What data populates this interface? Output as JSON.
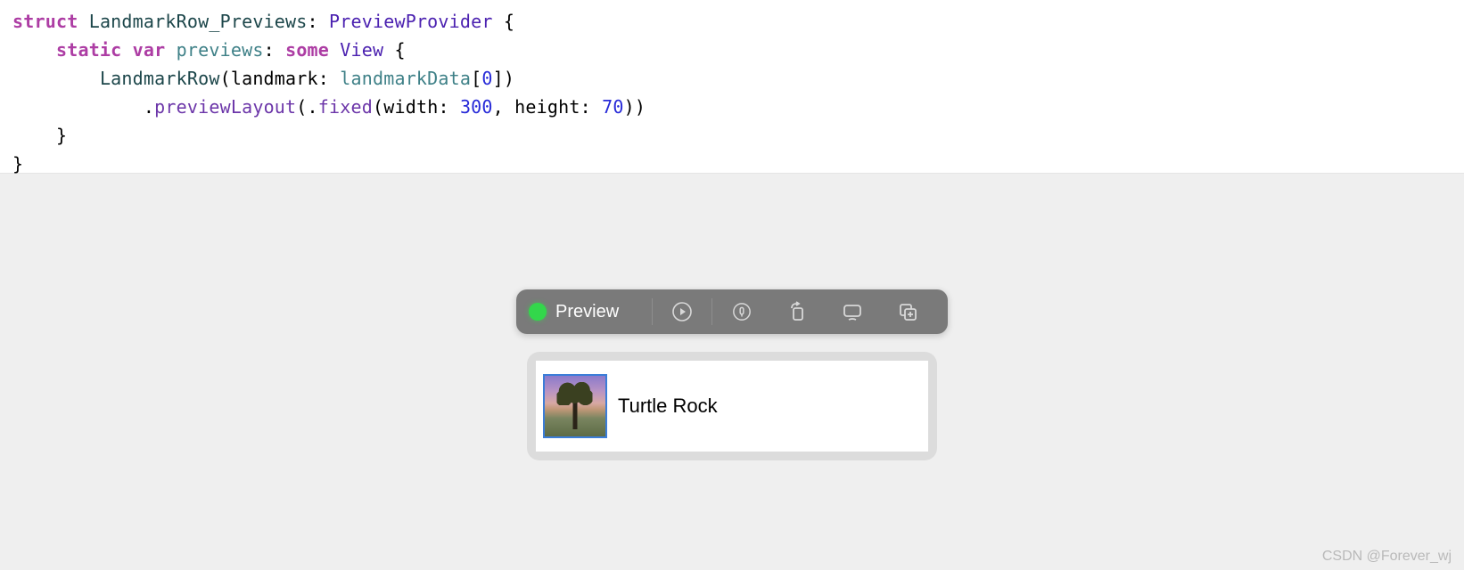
{
  "code": {
    "tokens": [
      {
        "indent": 0,
        "parts": [
          {
            "t": "struct",
            "c": "kw-pink"
          },
          {
            "t": " ",
            "c": "plain"
          },
          {
            "t": "LandmarkRow_Previews",
            "c": "type-teal"
          },
          {
            "t": ": ",
            "c": "plain"
          },
          {
            "t": "PreviewProvider",
            "c": "type-purple"
          },
          {
            "t": " {",
            "c": "plain"
          }
        ]
      },
      {
        "indent": 1,
        "parts": [
          {
            "t": "static",
            "c": "kw-pink"
          },
          {
            "t": " ",
            "c": "plain"
          },
          {
            "t": "var",
            "c": "kw-pink"
          },
          {
            "t": " ",
            "c": "plain"
          },
          {
            "t": "previews",
            "c": "member-teal"
          },
          {
            "t": ": ",
            "c": "plain"
          },
          {
            "t": "some",
            "c": "kw-pink"
          },
          {
            "t": " ",
            "c": "plain"
          },
          {
            "t": "View",
            "c": "type-purple"
          },
          {
            "t": " {",
            "c": "plain"
          }
        ]
      },
      {
        "indent": 2,
        "parts": [
          {
            "t": "LandmarkRow",
            "c": "type-teal"
          },
          {
            "t": "(landmark: ",
            "c": "plain"
          },
          {
            "t": "landmarkData",
            "c": "param-teal"
          },
          {
            "t": "[",
            "c": "plain"
          },
          {
            "t": "0",
            "c": "number-blue"
          },
          {
            "t": "])",
            "c": "plain"
          }
        ]
      },
      {
        "indent": 3,
        "parts": [
          {
            "t": ".",
            "c": "plain"
          },
          {
            "t": "previewLayout",
            "c": "method-purple"
          },
          {
            "t": "(.",
            "c": "plain"
          },
          {
            "t": "fixed",
            "c": "method-purple"
          },
          {
            "t": "(width: ",
            "c": "plain"
          },
          {
            "t": "300",
            "c": "number-blue"
          },
          {
            "t": ", height: ",
            "c": "plain"
          },
          {
            "t": "70",
            "c": "number-blue"
          },
          {
            "t": "))",
            "c": "plain"
          }
        ]
      },
      {
        "indent": 1,
        "parts": [
          {
            "t": "}",
            "c": "plain"
          }
        ]
      },
      {
        "indent": 0,
        "parts": [
          {
            "t": "}",
            "c": "plain"
          }
        ]
      }
    ]
  },
  "toolbar": {
    "status_color": "#33d74b",
    "label": "Preview",
    "buttons": [
      "live-preview",
      "pin",
      "rotate",
      "device-settings",
      "duplicate"
    ]
  },
  "preview": {
    "landmark_name": "Turtle Rock"
  },
  "watermark": "CSDN @Forever_wj"
}
